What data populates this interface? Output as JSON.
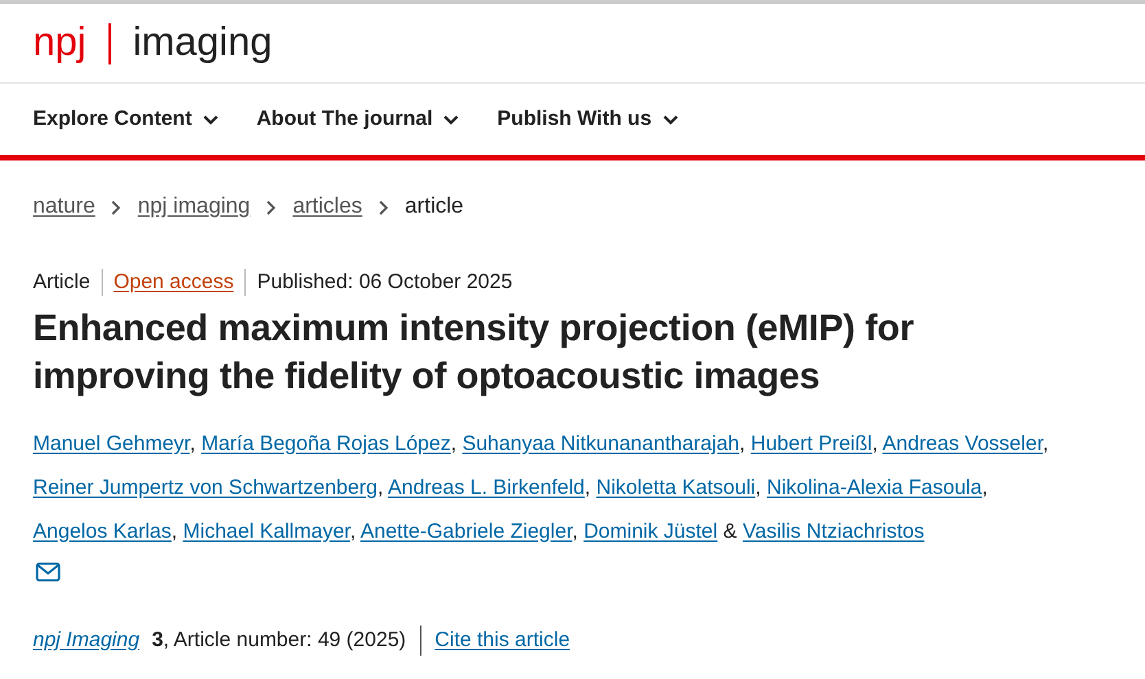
{
  "header": {
    "logo": {
      "brand": "npj",
      "journal": "imaging"
    }
  },
  "nav": [
    {
      "label": "Explore Content"
    },
    {
      "label": "About The journal"
    },
    {
      "label": "Publish With us"
    }
  ],
  "breadcrumbs": [
    {
      "label": "nature",
      "link": true
    },
    {
      "label": "npj imaging",
      "link": true
    },
    {
      "label": "articles",
      "link": true
    },
    {
      "label": "article",
      "link": false
    }
  ],
  "meta": {
    "type": "Article",
    "access": "Open access",
    "published": "Published: 06 October 2025"
  },
  "title": "Enhanced maximum intensity projection (eMIP) for improving the fidelity of optoacoustic images",
  "authors": [
    {
      "name": "Manuel Gehmeyr",
      "sep": ","
    },
    {
      "name": "María Begoña Rojas López",
      "sep": ","
    },
    {
      "name": "Suhanyaa Nitkunanantharajah",
      "sep": ","
    },
    {
      "name": "Hubert Preißl",
      "sep": ","
    },
    {
      "name": "Andreas Vosseler",
      "sep": ","
    },
    {
      "name": "Reiner Jumpertz von Schwartzenberg",
      "sep": ","
    },
    {
      "name": "Andreas L. Birkenfeld",
      "sep": ","
    },
    {
      "name": "Nikoletta Katsouli",
      "sep": ","
    },
    {
      "name": "Nikolina-Alexia Fasoula",
      "sep": ","
    },
    {
      "name": "Angelos Karlas",
      "sep": ","
    },
    {
      "name": "Michael Kallmayer",
      "sep": ","
    },
    {
      "name": "Anette-Gabriele Ziegler",
      "sep": ","
    },
    {
      "name": "Dominik Jüstel",
      "sep": "&"
    },
    {
      "name": "Vasilis Ntziachristos",
      "contact": true
    }
  ],
  "citation": {
    "journal": "npj Imaging",
    "volume": "3",
    "details": ", Article number: 49 (2025)",
    "cite": "Cite this article"
  }
}
